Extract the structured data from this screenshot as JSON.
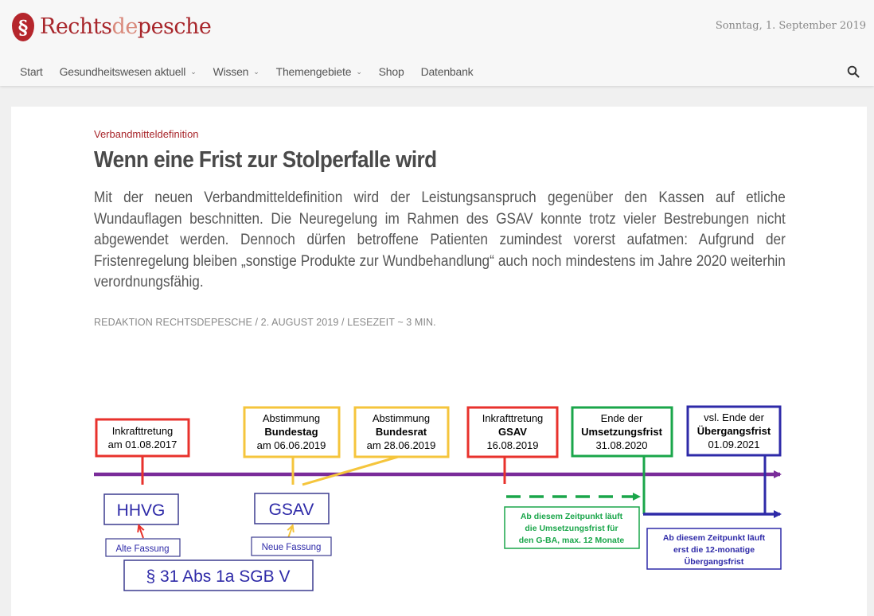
{
  "site": {
    "logo_part1": "Rechts",
    "logo_part2": "de",
    "logo_part3": "pesche",
    "date": "Sonntag, 1. September 2019"
  },
  "nav": {
    "items": [
      {
        "label": "Start",
        "dropdown": false
      },
      {
        "label": "Gesundheitswesen aktuell",
        "dropdown": true
      },
      {
        "label": "Wissen",
        "dropdown": true
      },
      {
        "label": "Themengebiete",
        "dropdown": true
      },
      {
        "label": "Shop",
        "dropdown": false
      },
      {
        "label": "Datenbank",
        "dropdown": false
      }
    ],
    "search_icon": "search-icon"
  },
  "article": {
    "category": "Verbandmitteldefinition",
    "title": "Wenn eine Frist zur Stolperfalle wird",
    "lead": "Mit der neuen Verbandmitteldefinition wird der Leistungsanspruch gegenüber den Kassen auf etliche Wundauflagen beschnitten. Die Neuregelung im Rahmen des GSAV konnte trotz vieler Bestrebungen nicht abgewendet werden. Dennoch dürfen betroffene Patienten zumindest vorerst aufatmen: Aufgrund der Fristenregelung bleiben „sonstige Produkte zur Wundbehandlung“ auch noch mindestens im Jahre 2020 weiterhin verordnungsfähig.",
    "byline": "REDAKTION RECHTSDEPESCHE / 2. AUGUST 2019 / LESEZEIT ~ 3 MIN."
  },
  "timeline": {
    "events": [
      {
        "line1": "Inkrafttretung",
        "line2": "am 01.08.2017",
        "line3": "",
        "color": "#e8322c"
      },
      {
        "line1": "Abstimmung",
        "line2": "Bundestag",
        "line3": "am 06.06.2019",
        "color": "#f5c53c"
      },
      {
        "line1": "Abstimmung",
        "line2": "Bundesrat",
        "line3": "am 28.06.2019",
        "color": "#f5c53c"
      },
      {
        "line1": "Inkrafttretung",
        "line2": "GSAV",
        "line3": "16.08.2019",
        "color": "#e8322c"
      },
      {
        "line1": "Ende der",
        "line2": "Umsetzungsfrist",
        "line3": "31.08.2020",
        "color": "#1aa64a"
      },
      {
        "line1": "vsl. Ende der",
        "line2": "Übergangsfrist",
        "line3": "01.09.2021",
        "color": "#2e2aa8"
      }
    ],
    "laws": {
      "hhvg": "HHVG",
      "gsav": "GSAV",
      "alte_fassung": "Alte Fassung",
      "neue_fassung": "Neue Fassung",
      "sgb": "§ 31 Abs 1a SGB V"
    },
    "notes": {
      "green": [
        "Ab diesem Zeitpunkt läuft",
        "die Umsetzungsfrist für",
        "den G-BA, max. 12 Monate"
      ],
      "blue": [
        "Ab diesem Zeitpunkt läuft",
        "erst die 12-monatige",
        "Übergangsfrist"
      ]
    },
    "colors": {
      "axis": "#7a2c9a",
      "red": "#e8322c",
      "yellow": "#f5c53c",
      "green": "#1aa64a",
      "blue": "#2e2aa8",
      "law_box": "#3b3b8f"
    }
  }
}
